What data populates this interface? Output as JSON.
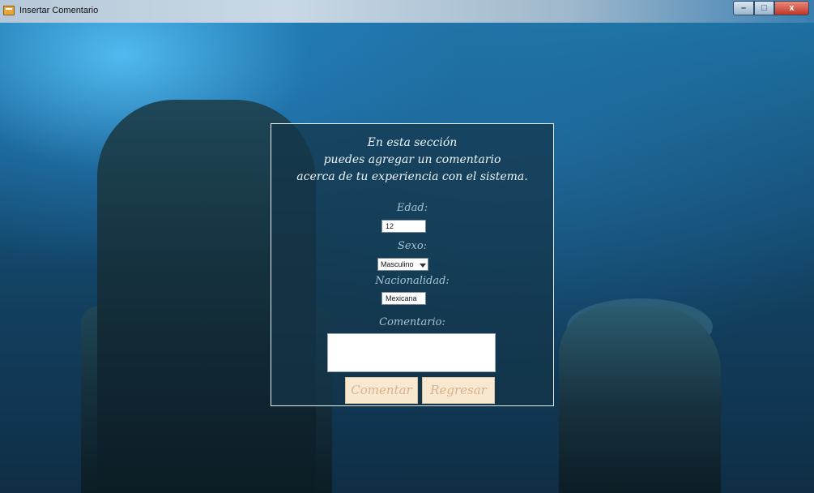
{
  "window": {
    "title": "Insertar Comentario",
    "buttons": {
      "minimize": "–",
      "maximize": "□",
      "close": "x"
    }
  },
  "panel": {
    "intro_lines": [
      "En esta sección",
      "puedes agregar un comentario",
      "acerca de tu experiencia con el sistema."
    ],
    "edad": {
      "label": "Edad:",
      "value": "12"
    },
    "sexo": {
      "label": "Sexo:",
      "value": "Masculino"
    },
    "nacionalidad": {
      "label": "Nacionalidad:",
      "value": "Mexicana"
    },
    "comentario": {
      "label": "Comentario:",
      "value": ""
    },
    "buttons": {
      "comentar": "Comentar",
      "regresar": "Regresar"
    }
  },
  "colors": {
    "panel_border": "#e6edf3",
    "label": "#a9c3d3",
    "button_bg": "#f7e8cf",
    "button_text": "#d8b18a"
  }
}
